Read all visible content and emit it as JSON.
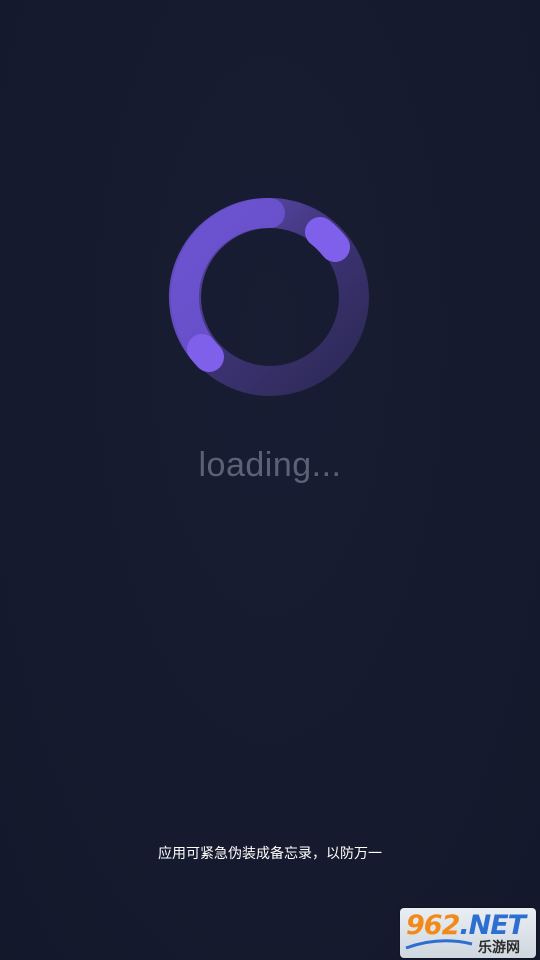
{
  "loading": {
    "text": "loading..."
  },
  "hint": {
    "text": "应用可紧急伪装成备忘录，以防万一"
  },
  "watermark": {
    "digits": "962",
    "suffix": ".NET",
    "subtitle": "乐游网"
  },
  "colors": {
    "background": "#161a2e",
    "spinner_accent": "#7b5ce0",
    "spinner_track": "#3a2f6e",
    "loading_text": "#5d6178",
    "hint_text": "#ffffff"
  },
  "icons": {
    "spinner": "loading-ring-icon"
  }
}
